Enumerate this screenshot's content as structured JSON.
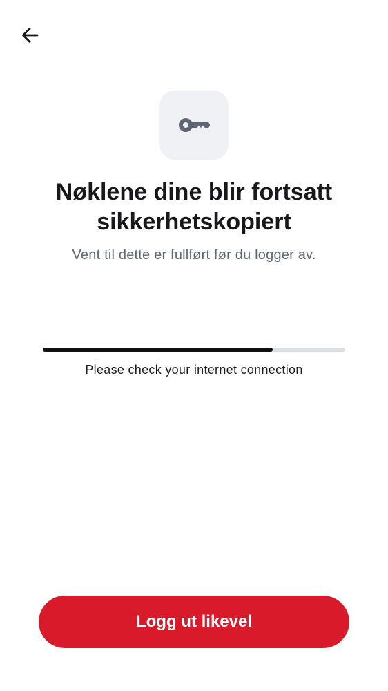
{
  "header": {
    "back_icon": "arrow-left-icon"
  },
  "hero": {
    "icon": "key-icon",
    "title_line1": "Nøklene dine blir fortsatt",
    "title_line2": "sikkerhetskopiert",
    "subtitle": "Vent til dette er fullført før du logger av."
  },
  "progress": {
    "fraction": 0.76,
    "status_text": "Please check your internet connection"
  },
  "actions": {
    "logout_label": "Logg ut likevel"
  },
  "colors": {
    "accent": "#d91a2a",
    "progress_fill": "#111214",
    "progress_track": "#dcdfe5",
    "icon_tile": "#eff1f5"
  }
}
